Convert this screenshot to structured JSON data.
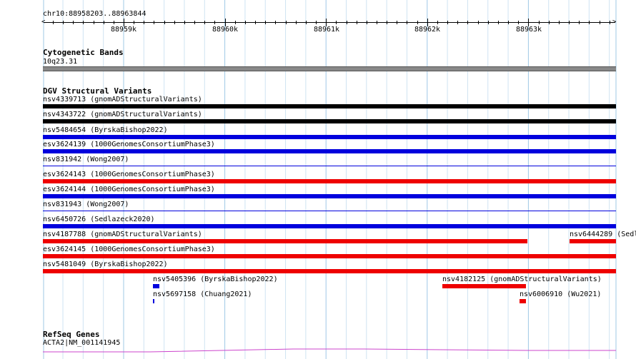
{
  "region": "chr10:88958203..88963844",
  "ruler": {
    "ticks": [
      "88959k",
      "88960k",
      "88961k",
      "88962k",
      "88963k"
    ]
  },
  "tracks": {
    "cytogenetic": {
      "title": "Cytogenetic Bands",
      "band": "10q23.31"
    },
    "dgv": {
      "title": "DGV Structural Variants",
      "features": [
        {
          "label": "nsv4339713 (gnomADStructuralVariants)",
          "color": "#000000"
        },
        {
          "label": "nsv4343722 (gnomADStructuralVariants)",
          "color": "#000000"
        },
        {
          "label": "nsv5484654 (ByrskaBishop2022)",
          "color": "#0000dd"
        },
        {
          "label": "esv3624139 (1000GenomesConsortiumPhase3)",
          "color": "#0000dd"
        },
        {
          "label": "nsv831942 (Wong2007)",
          "color": "#0000dd"
        },
        {
          "label": "esv3624143 (1000GenomesConsortiumPhase3)",
          "color": "#ee0000"
        },
        {
          "label": "esv3624144 (1000GenomesConsortiumPhase3)",
          "color": "#0000dd"
        },
        {
          "label": "nsv831943 (Wong2007)",
          "color": "#0000dd"
        },
        {
          "label": "nsv6450726 (Sedlazeck2020)",
          "color": "#0000dd"
        },
        {
          "label": "nsv4187788 (gnomADStructuralVariants)",
          "color": "#ee0000"
        },
        {
          "label": "nsv6444289 (Sedl",
          "color": "#ee0000"
        },
        {
          "label": "esv3624145 (1000GenomesConsortiumPhase3)",
          "color": "#ee0000"
        },
        {
          "label": "nsv5481049 (ByrskaBishop2022)",
          "color": "#ee0000"
        },
        {
          "label": "nsv5405396 (ByrskaBishop2022)",
          "color": "#0000dd"
        },
        {
          "label": "nsv4182125 (gnomADStructuralVariants)",
          "color": "#ee0000"
        },
        {
          "label": "nsv5697158 (Chuang2021)",
          "color": "#0000dd"
        },
        {
          "label": "nsv6006910 (Wu2021)",
          "color": "#ee0000"
        }
      ]
    },
    "refseq": {
      "title": "RefSeq Genes",
      "gene": "ACTA2|NM_001141945",
      "color": "#cc44cc"
    }
  }
}
